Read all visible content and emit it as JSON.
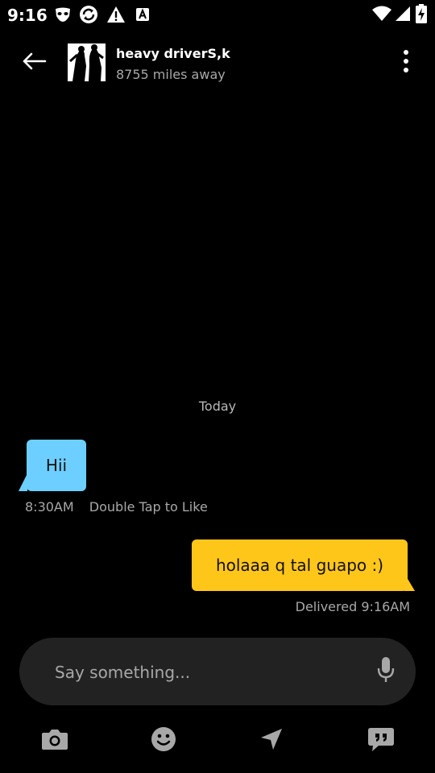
{
  "status_bar": {
    "time": "9:16",
    "icons": [
      "grindr-mask-icon",
      "sync-icon",
      "warning-icon",
      "a-icon",
      "wifi-icon",
      "signal-icon",
      "battery-charging-icon"
    ]
  },
  "header": {
    "back_icon": "back-arrow-icon",
    "contact_name": "heavy driverS,k",
    "distance": "8755 miles away",
    "more_icon": "more-vertical-icon"
  },
  "conversation": {
    "date_separator": "Today",
    "messages": [
      {
        "direction": "incoming",
        "text": "Hii",
        "time": "8:30AM",
        "hint": "Double Tap to Like",
        "bubble_color": "#6ccfff"
      },
      {
        "direction": "outgoing",
        "text": "holaaa q tal guapo :)",
        "status": "Delivered 9:16AM",
        "bubble_color": "#ffc61a"
      }
    ]
  },
  "composer": {
    "placeholder": "Say something...",
    "value": "",
    "mic_icon": "microphone-icon"
  },
  "toolbar": {
    "items": [
      "camera-icon",
      "emoji-icon",
      "location-arrow-icon",
      "saved-phrases-icon"
    ]
  },
  "colors": {
    "background": "#000000",
    "incoming_bubble": "#6ccfff",
    "outgoing_bubble": "#ffc61a",
    "composer_bg": "#222222",
    "secondary_text": "#a8a8a8"
  }
}
